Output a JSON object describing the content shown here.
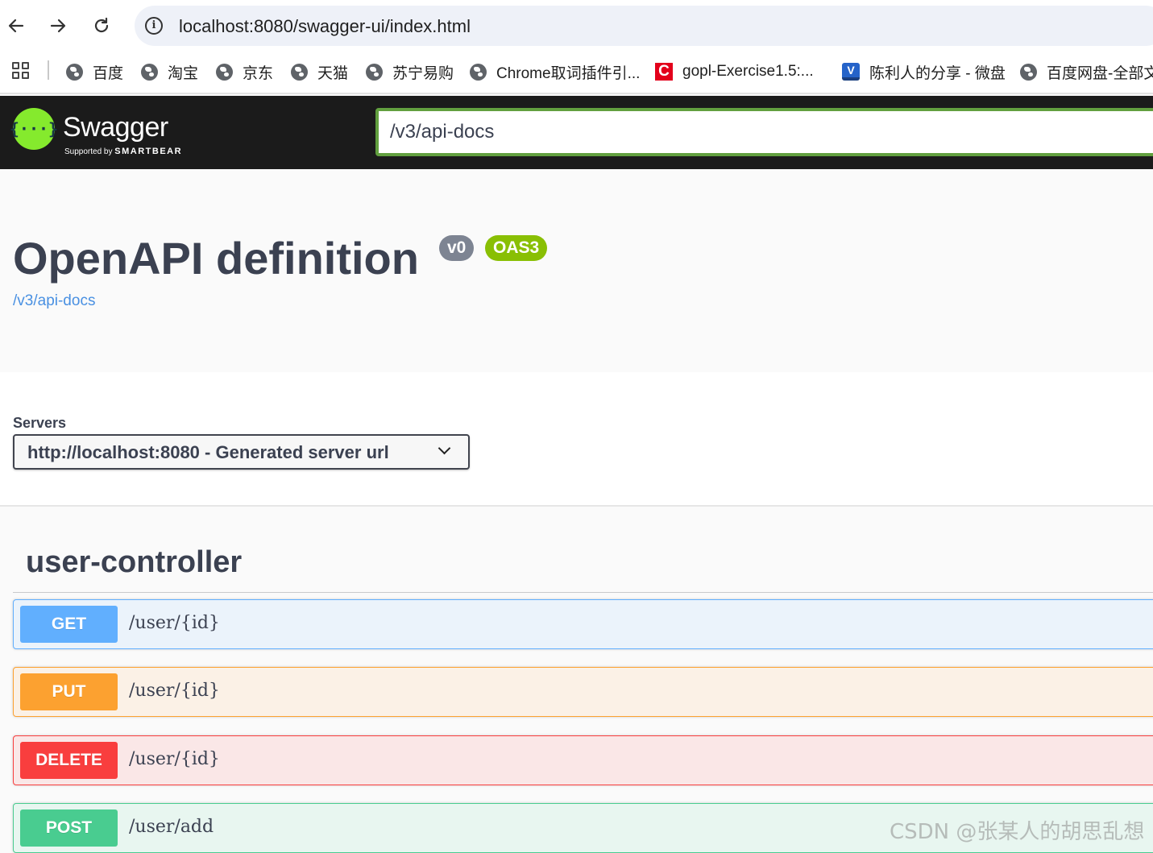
{
  "browser": {
    "url": "localhost:8080/swagger-ui/index.html",
    "bookmarks": [
      {
        "label": "百度",
        "icon": "globe-icon"
      },
      {
        "label": "淘宝",
        "icon": "globe-icon"
      },
      {
        "label": "京东",
        "icon": "globe-icon"
      },
      {
        "label": "天猫",
        "icon": "globe-icon"
      },
      {
        "label": "苏宁易购",
        "icon": "globe-icon"
      },
      {
        "label": "Chrome取词插件引...",
        "icon": "globe-icon"
      },
      {
        "label": "gopl-Exercise1.5:...",
        "icon": "csdn-icon"
      },
      {
        "label": "陈利人的分享 - 微盘",
        "icon": "weipan-icon"
      },
      {
        "label": "百度网盘-全部文",
        "icon": "globe-icon"
      }
    ]
  },
  "topbar": {
    "logo_name": "Swagger",
    "logo_sub_prefix": "Supported by",
    "logo_sub_brand": "SMARTBEAR",
    "spec_url": "/v3/api-docs",
    "accent": "#85ea2d"
  },
  "info": {
    "title": "OpenAPI definition",
    "version": "v0",
    "oas_badge": "OAS3",
    "spec_link": "/v3/api-docs"
  },
  "servers": {
    "label": "Servers",
    "selected": "http://localhost:8080 - Generated server url"
  },
  "tag": {
    "name": "user-controller",
    "operations": [
      {
        "method": "GET",
        "path": "/user/{id}",
        "color": "#61affe"
      },
      {
        "method": "PUT",
        "path": "/user/{id}",
        "color": "#fca130"
      },
      {
        "method": "DELETE",
        "path": "/user/{id}",
        "color": "#f93e3e"
      },
      {
        "method": "POST",
        "path": "/user/add",
        "color": "#49cc90"
      }
    ]
  },
  "watermark": "CSDN @张某人的胡思乱想"
}
